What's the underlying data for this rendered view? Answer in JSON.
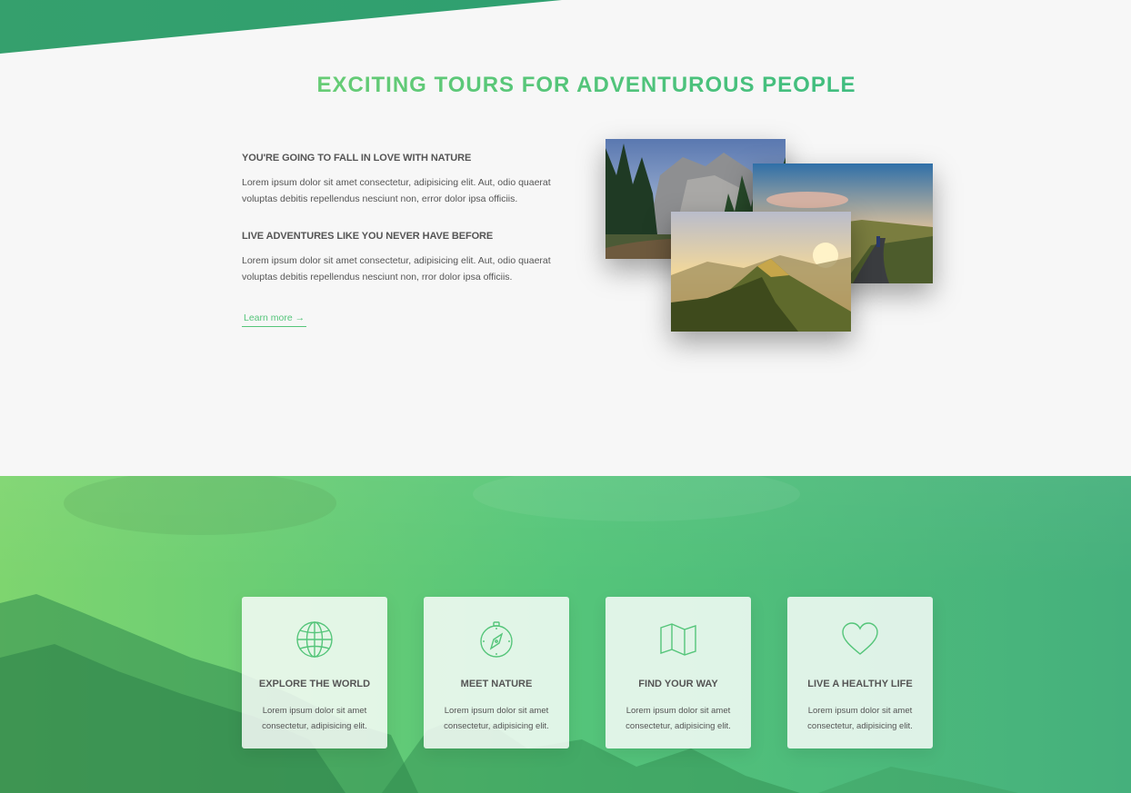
{
  "about": {
    "heading": "EXCITING TOURS FOR ADVENTUROUS PEOPLE",
    "blocks": [
      {
        "title": "YOU'RE GOING TO FALL IN LOVE WITH NATURE",
        "text": "Lorem ipsum dolor sit amet consectetur, adipisicing elit. Aut, odio quaerat voluptas debitis repellendus nesciunt non, error dolor ipsa officiis."
      },
      {
        "title": "LIVE ADVENTURES LIKE YOU NEVER HAVE BEFORE",
        "text": "Lorem ipsum dolor sit amet consectetur, adipisicing elit. Aut, odio quaerat voluptas debitis repellendus nesciunt non, rror dolor ipsa officiis."
      }
    ],
    "learn_more": "Learn more →",
    "photos": [
      "forest-cliffs-photo",
      "hiker-road-sunset-photo",
      "mountain-ridge-sunrise-photo"
    ]
  },
  "features": [
    {
      "icon": "globe-icon",
      "title": "EXPLORE THE WORLD",
      "text": "Lorem ipsum dolor sit amet consectetur, adipisicing elit."
    },
    {
      "icon": "compass-icon",
      "title": "MEET NATURE",
      "text": "Lorem ipsum dolor sit amet consectetur, adipisicing elit."
    },
    {
      "icon": "map-icon",
      "title": "FIND YOUR WAY",
      "text": "Lorem ipsum dolor sit amet consectetur, adipisicing elit."
    },
    {
      "icon": "heart-icon",
      "title": "LIVE A HEALTHY LIFE",
      "text": "Lorem ipsum dolor sit amet consectetur, adipisicing elit."
    }
  ],
  "colors": {
    "primary": "#55c57a",
    "primary_light": "#7ed56f",
    "primary_dark": "#28b485",
    "text": "#555555",
    "background": "#f7f7f7"
  }
}
